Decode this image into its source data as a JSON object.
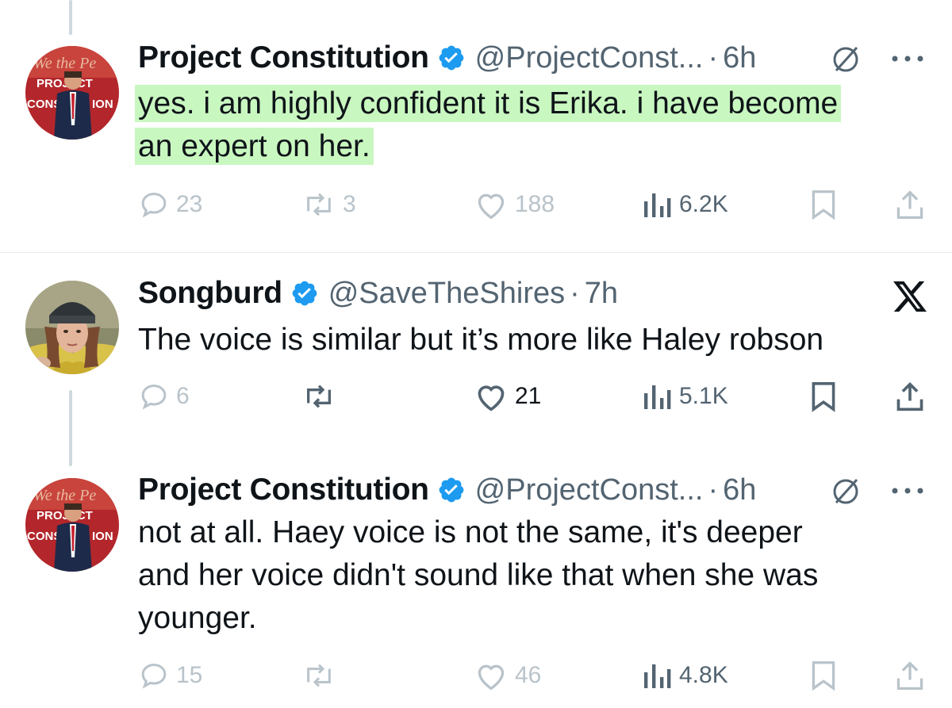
{
  "tweets": [
    {
      "author": "Project Constitution",
      "handle": "@ProjectConst...",
      "separator": "·",
      "time": "6h",
      "text_lines": [
        "yes. i am highly confident it is Erika. i have become",
        "an expert on her."
      ],
      "highlighted": true,
      "avatar_text": [
        "PROJECT",
        "CONS",
        "ION"
      ],
      "stats": {
        "replies": "23",
        "reposts": "3",
        "likes": "188",
        "views": "6.2K"
      }
    },
    {
      "author": "Songburd",
      "handle": "@SaveTheShires",
      "separator": "·",
      "time": "7h",
      "text_lines": [
        "The voice is similar but it’s more like Haley robson"
      ],
      "highlighted": false,
      "stats": {
        "replies": "6",
        "reposts": "",
        "likes": "21",
        "views": "5.1K"
      }
    },
    {
      "author": "Project Constitution",
      "handle": "@ProjectConst...",
      "separator": "·",
      "time": "6h",
      "text_lines": [
        "not at all. Haey voice is not the same, it's deeper",
        "and her voice didn't sound like that when she was",
        "younger."
      ],
      "highlighted": false,
      "avatar_text": [
        "PROJECT",
        "CONS",
        "ION"
      ],
      "stats": {
        "replies": "15",
        "reposts": "",
        "likes": "46",
        "views": "4.8K"
      }
    }
  ],
  "icons": {
    "verified": "verified-badge-icon",
    "grok": "grok-icon",
    "more": "more-icon",
    "x_logo": "x-logo-icon",
    "reply": "reply-icon",
    "repost": "repost-icon",
    "like": "like-icon",
    "views": "views-icon",
    "bookmark": "bookmark-icon",
    "share": "share-icon"
  },
  "colors": {
    "verified": "#1d9bf0",
    "highlight": "#c9f7c0",
    "text": "#0f1419",
    "secondary": "#536471",
    "faded": "#b9c3ca",
    "thread_line": "#cfd9de"
  }
}
